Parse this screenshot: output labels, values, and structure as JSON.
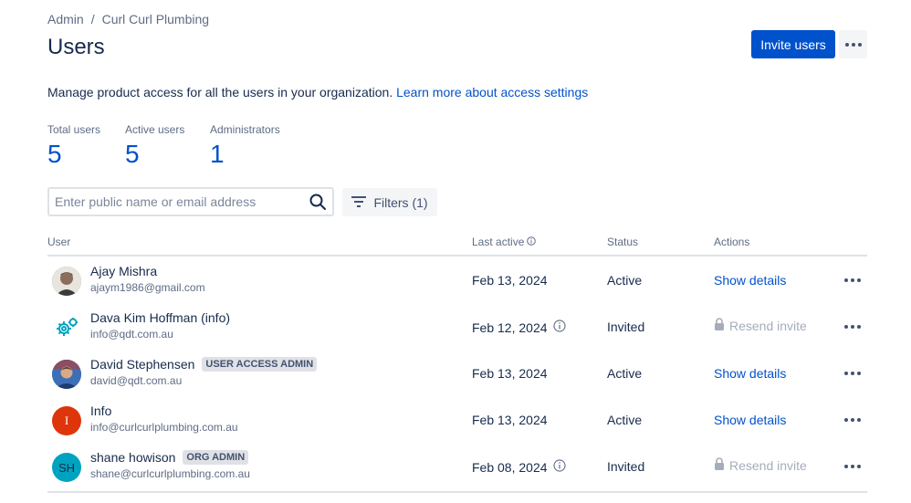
{
  "breadcrumb": {
    "root": "Admin",
    "separator": "/",
    "org": "Curl Curl Plumbing"
  },
  "page": {
    "title": "Users"
  },
  "actions": {
    "invite_label": "Invite users"
  },
  "description": {
    "text": "Manage product access for all the users in your organization.",
    "link": "Learn more about access settings"
  },
  "stats": [
    {
      "label": "Total users",
      "value": "5"
    },
    {
      "label": "Active users",
      "value": "5"
    },
    {
      "label": "Administrators",
      "value": "1"
    }
  ],
  "search": {
    "placeholder": "Enter public name or email address"
  },
  "filters": {
    "label": "Filters (1)"
  },
  "table": {
    "headers": {
      "user": "User",
      "last_active": "Last active",
      "status": "Status",
      "actions": "Actions"
    },
    "rows": [
      {
        "name": "Ajay Mishra",
        "email": "ajaym1986@gmail.com",
        "badge": "",
        "last_active": "Feb 13, 2024",
        "status": "Active",
        "action": "Show details",
        "avatar_initials": ""
      },
      {
        "name": "Dava Kim Hoffman (info)",
        "email": "info@qdt.com.au",
        "badge": "",
        "last_active": "Feb 12, 2024",
        "status": "Invited",
        "action": "Resend invite",
        "avatar_initials": ""
      },
      {
        "name": "David Stephensen",
        "email": "david@qdt.com.au",
        "badge": "USER ACCESS ADMIN",
        "last_active": "Feb 13, 2024",
        "status": "Active",
        "action": "Show details",
        "avatar_initials": ""
      },
      {
        "name": "Info",
        "email": "info@curlcurlplumbing.com.au",
        "badge": "",
        "last_active": "Feb 13, 2024",
        "status": "Active",
        "action": "Show details",
        "avatar_initials": "I"
      },
      {
        "name": "shane howison",
        "email": "shane@curlcurlplumbing.com.au",
        "badge": "ORG ADMIN",
        "last_active": "Feb 08, 2024",
        "status": "Invited",
        "action": "Resend invite",
        "avatar_initials": "SH"
      }
    ]
  },
  "colors": {
    "primary": "#0052cc",
    "text": "#172b4d",
    "subtle": "#5e6c84",
    "disabled": "#a5adba",
    "avatar_info": "#de350b",
    "avatar_sh": "#00a3bf"
  }
}
